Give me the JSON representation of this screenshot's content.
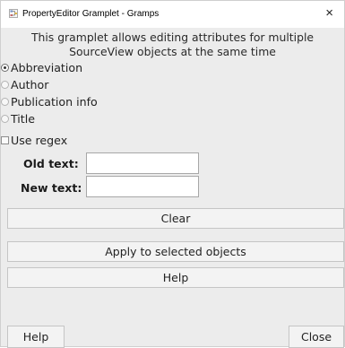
{
  "window": {
    "title": "PropertyEditor Gramplet - Gramps",
    "close_glyph": "×",
    "app_icon": "gramps-tree-icon",
    "close_icon": "close-icon"
  },
  "description": {
    "line1": "This gramplet allows editing attributes for multiple",
    "line2": "SourceView objects at the same time"
  },
  "attributes": {
    "selected": "Abbreviation",
    "options": [
      {
        "label": "Abbreviation",
        "checked": true
      },
      {
        "label": "Author",
        "checked": false
      },
      {
        "label": "Publication info",
        "checked": false
      },
      {
        "label": "Title",
        "checked": false
      }
    ]
  },
  "use_regex": {
    "label": "Use regex",
    "checked": false
  },
  "old_text": {
    "label": "Old text:",
    "value": ""
  },
  "new_text": {
    "label": "New text:",
    "value": ""
  },
  "buttons": {
    "clear": "Clear",
    "apply": "Apply to selected objects",
    "help_main": "Help",
    "help_bottom": "Help",
    "close": "Close"
  },
  "colors": {
    "window_bg": "#ececec",
    "button_bg": "#f3f3f3",
    "titlebar_bg": "#ffffff"
  }
}
